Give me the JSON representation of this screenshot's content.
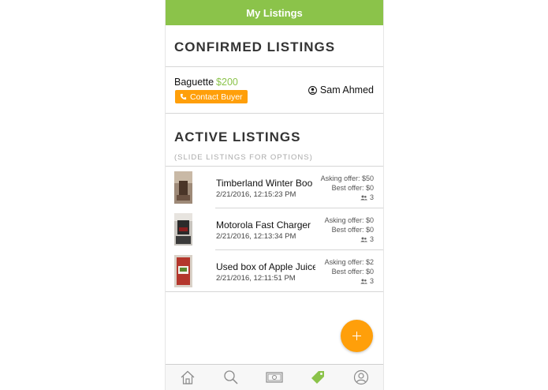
{
  "header": {
    "title": "My Listings"
  },
  "confirmed": {
    "title": "CONFIRMED LISTINGS",
    "item": {
      "name": "Baguette",
      "price": "$200",
      "contact_label": "Contact Buyer",
      "buyer_name": "Sam Ahmed",
      "icons": {
        "phone": "phone-icon",
        "user": "user-circle-icon"
      }
    }
  },
  "active": {
    "title": "ACTIVE LISTINGS",
    "subtitle": "(SLIDE LISTINGS FOR OPTIONS)",
    "items": [
      {
        "title": "Timberland Winter Boo",
        "date": "2/21/2016, 12:15:23 PM",
        "asking": "Asking offer: $50",
        "best": "Best offer: $0",
        "watchers": "3"
      },
      {
        "title": "Motorola Fast Charger",
        "date": "2/21/2016, 12:13:34 PM",
        "asking": "Asking offer: $0",
        "best": "Best offer: $0",
        "watchers": "3"
      },
      {
        "title": "Used box of Apple Juice",
        "date": "2/21/2016, 12:11:51 PM",
        "asking": "Asking offer: $2",
        "best": "Best offer: $0",
        "watchers": "3"
      }
    ]
  },
  "fab": {
    "icon": "plus-icon"
  },
  "tabbar": {
    "tabs": [
      "home-icon",
      "search-icon",
      "money-icon",
      "tag-icon",
      "profile-icon"
    ],
    "active_tab": "tag-icon"
  },
  "colors": {
    "accent_green": "#8bc34a",
    "accent_orange": "#ff9f0a"
  }
}
